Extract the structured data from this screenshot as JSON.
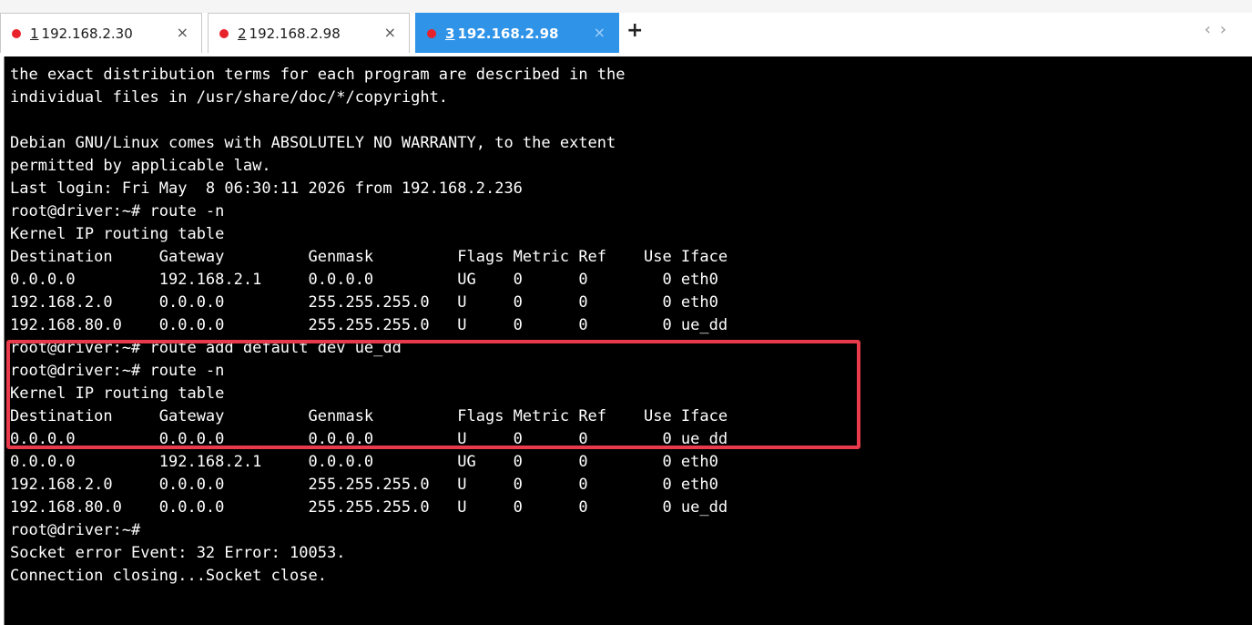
{
  "tabs": [
    {
      "number": "1",
      "host": "192.168.2.30",
      "status_color": "#e8222a",
      "close": "×",
      "active": false
    },
    {
      "number": "2",
      "host": "192.168.2.98",
      "status_color": "#e8222a",
      "close": "×",
      "active": false
    },
    {
      "number": "3",
      "host": "192.168.2.98",
      "status_color": "#e8222a",
      "close": "×",
      "active": true
    }
  ],
  "new_tab_label": "+",
  "nav": {
    "prev": "‹",
    "next": "›"
  },
  "colors": {
    "active_tab": "#2f93e8",
    "terminal_bg": "#000000",
    "terminal_fg": "#ffffff",
    "highlight": "#e83a4a"
  },
  "terminal": {
    "lines": [
      "the exact distribution terms for each program are described in the",
      "individual files in /usr/share/doc/*/copyright.",
      "",
      "Debian GNU/Linux comes with ABSOLUTELY NO WARRANTY, to the extent",
      "permitted by applicable law.",
      "Last login: Fri May  8 06:30:11 2026 from 192.168.2.236",
      "root@driver:~# route -n",
      "Kernel IP routing table",
      "Destination     Gateway         Genmask         Flags Metric Ref    Use Iface",
      "0.0.0.0         192.168.2.1     0.0.0.0         UG    0      0        0 eth0",
      "192.168.2.0     0.0.0.0         255.255.255.0   U     0      0        0 eth0",
      "192.168.80.0    0.0.0.0         255.255.255.0   U     0      0        0 ue_dd",
      "root@driver:~# route add default dev ue_dd",
      "root@driver:~# route -n",
      "Kernel IP routing table",
      "Destination     Gateway         Genmask         Flags Metric Ref    Use Iface",
      "0.0.0.0         0.0.0.0         0.0.0.0         U     0      0        0 ue_dd",
      "0.0.0.0         192.168.2.1     0.0.0.0         UG    0      0        0 eth0",
      "192.168.2.0     0.0.0.0         255.255.255.0   U     0      0        0 eth0",
      "192.168.80.0    0.0.0.0         255.255.255.0   U     0      0        0 ue_dd",
      "root@driver:~#",
      "Socket error Event: 32 Error: 10053.",
      "Connection closing...Socket close."
    ]
  }
}
